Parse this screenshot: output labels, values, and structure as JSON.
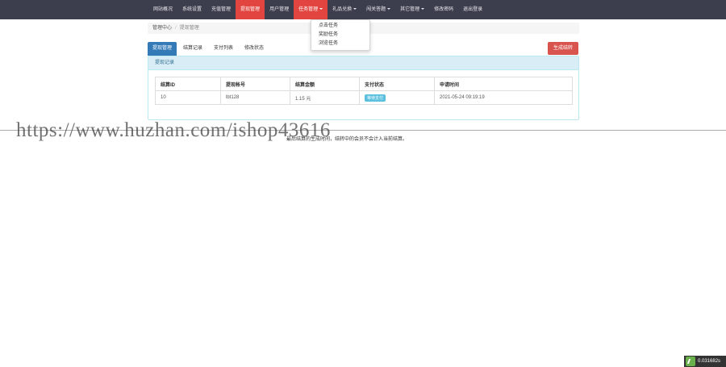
{
  "nav": {
    "items": [
      {
        "label": "网站概况",
        "state": "normal",
        "caret": false
      },
      {
        "label": "系统设置",
        "state": "normal",
        "caret": false
      },
      {
        "label": "充值管理",
        "state": "normal",
        "caret": false
      },
      {
        "label": "提现管理",
        "state": "active",
        "caret": false
      },
      {
        "label": "用户管理",
        "state": "normal",
        "caret": false
      },
      {
        "label": "任务管理",
        "state": "open",
        "caret": true
      },
      {
        "label": "礼品兑换",
        "state": "normal",
        "caret": true
      },
      {
        "label": "闯关答题",
        "state": "normal",
        "caret": true
      },
      {
        "label": "其它管理",
        "state": "normal",
        "caret": true
      },
      {
        "label": "修改密码",
        "state": "normal",
        "caret": false
      },
      {
        "label": "退出登录",
        "state": "normal",
        "caret": false
      }
    ],
    "dropdown": [
      "点击任务",
      "奖励任务",
      "浏览任务"
    ]
  },
  "breadcrumb": {
    "home": "管理中心",
    "current": "提现管理"
  },
  "tabs": [
    "提现管理",
    "结算记录",
    "支付列表",
    "修改状态"
  ],
  "generate_button": "生成结转",
  "panel_title": "提现记录",
  "table": {
    "headers": [
      "结算ID",
      "提现帐号",
      "结算金额",
      "支付状态",
      "申请时间"
    ],
    "rows": [
      {
        "id": "10",
        "account": "lbt128",
        "amount": "1.15 元",
        "status": "等待支付",
        "time": "2021-05-24 09:19:19"
      }
    ]
  },
  "watermark": "https://www.huzhan.com/ishop43616",
  "footer_note": "最后结算的生成时间，结转中的会员不会计入当前结算。",
  "timer": "0.031682s",
  "colors": {
    "navbar": "#3c3e4d",
    "active": "#e2453f",
    "tab_active": "#337ab7",
    "danger": "#d9534f",
    "info": "#5bc0de"
  }
}
